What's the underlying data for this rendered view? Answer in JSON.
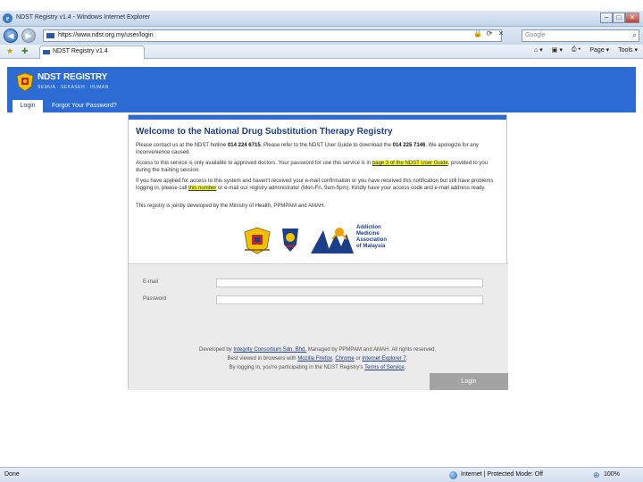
{
  "window": {
    "title": "NDST Registry v1.4 - Windows Internet Explorer",
    "controls": {
      "minimize": "–",
      "maximize": "□",
      "close": "✕"
    }
  },
  "addressbar": {
    "url": "https://www.ndst.org.my/user/login",
    "search_placeholder": "Google"
  },
  "tabbar": {
    "tab_title": "NDST Registry v1.4",
    "commands": [
      "Page ▾",
      "Tools ▾"
    ]
  },
  "header": {
    "brand": "NDST REGISTRY",
    "subtitle": "SEMUA · SEKASEH · HUMAN"
  },
  "nav": {
    "login_tab": "Login",
    "forgot_tab": "Forgot Your Password?"
  },
  "welcome": {
    "title": "Welcome to the National Drug Substitution Therapy Registry",
    "p1_a": "Please contact us at the NDST hotline ",
    "p1_phone1": "014 224 6715",
    "p1_b": ". Please refer to the NDST User Guide to download the ",
    "p1_phone2": "014 225 7146",
    "p1_c": ". We apologize for any inconvenience caused.",
    "p2_a": "Access to this service is only available to approved doctors. Your password for use this service is in ",
    "p2_link": "page 3 of the NDST User Guide",
    "p2_b": ", provided to you during the training session.",
    "p3_a": "If you have applied for access to this system and haven't received your e-mail confirmation or you have received this notification but still have problems logging in, please call ",
    "p3_link": "this number",
    "p3_b": " or e-mail our registry administrator (Mon-Fri, 9am-5pm). Kindly have your access code and e-mail address ready.",
    "p4": "This registry is jointly developed by the Ministry of Health, PPMPAM and AMAH.",
    "aam_name": "Addiction\nMedicine\nAssociation\nof Malaysia"
  },
  "login": {
    "email_label": "E-mail",
    "password_label": "Password",
    "button_label": "Login"
  },
  "footer": {
    "line1_a": "Developed by ",
    "line1_link": "Integrity Consortium Sdn. Bhd.",
    "line1_b": " Managed by PPMPAM and AMAH. All rights reserved.",
    "line2_a": "Best viewed in browsers with ",
    "line2_link1": "Mozilla Firefox",
    "line2_sep": ", ",
    "line2_link2": "Chrome",
    "line2_or": " or ",
    "line2_link3": "Internet Explorer 7",
    "line2_end": ".",
    "line3_a": "By logging in, you're participating in the NDST Registry's ",
    "line3_link": "Terms of Service",
    "line3_end": "."
  },
  "statusbar": {
    "status": "Done",
    "zone": "Internet | Protected Mode: Off",
    "zoom": "100%"
  },
  "colors": {
    "header_blue": "#2b6bd3",
    "title_blue": "#1e3f86",
    "highlight": "#fff200"
  },
  "icons": [
    "ie-icon",
    "back-icon",
    "forward-icon",
    "lock-icon",
    "refresh-icon",
    "stop-icon",
    "search-icon",
    "favorites-star-icon",
    "add-favorite-icon",
    "home-icon",
    "feeds-icon",
    "print-icon",
    "globe-icon",
    "zoom-icon"
  ]
}
